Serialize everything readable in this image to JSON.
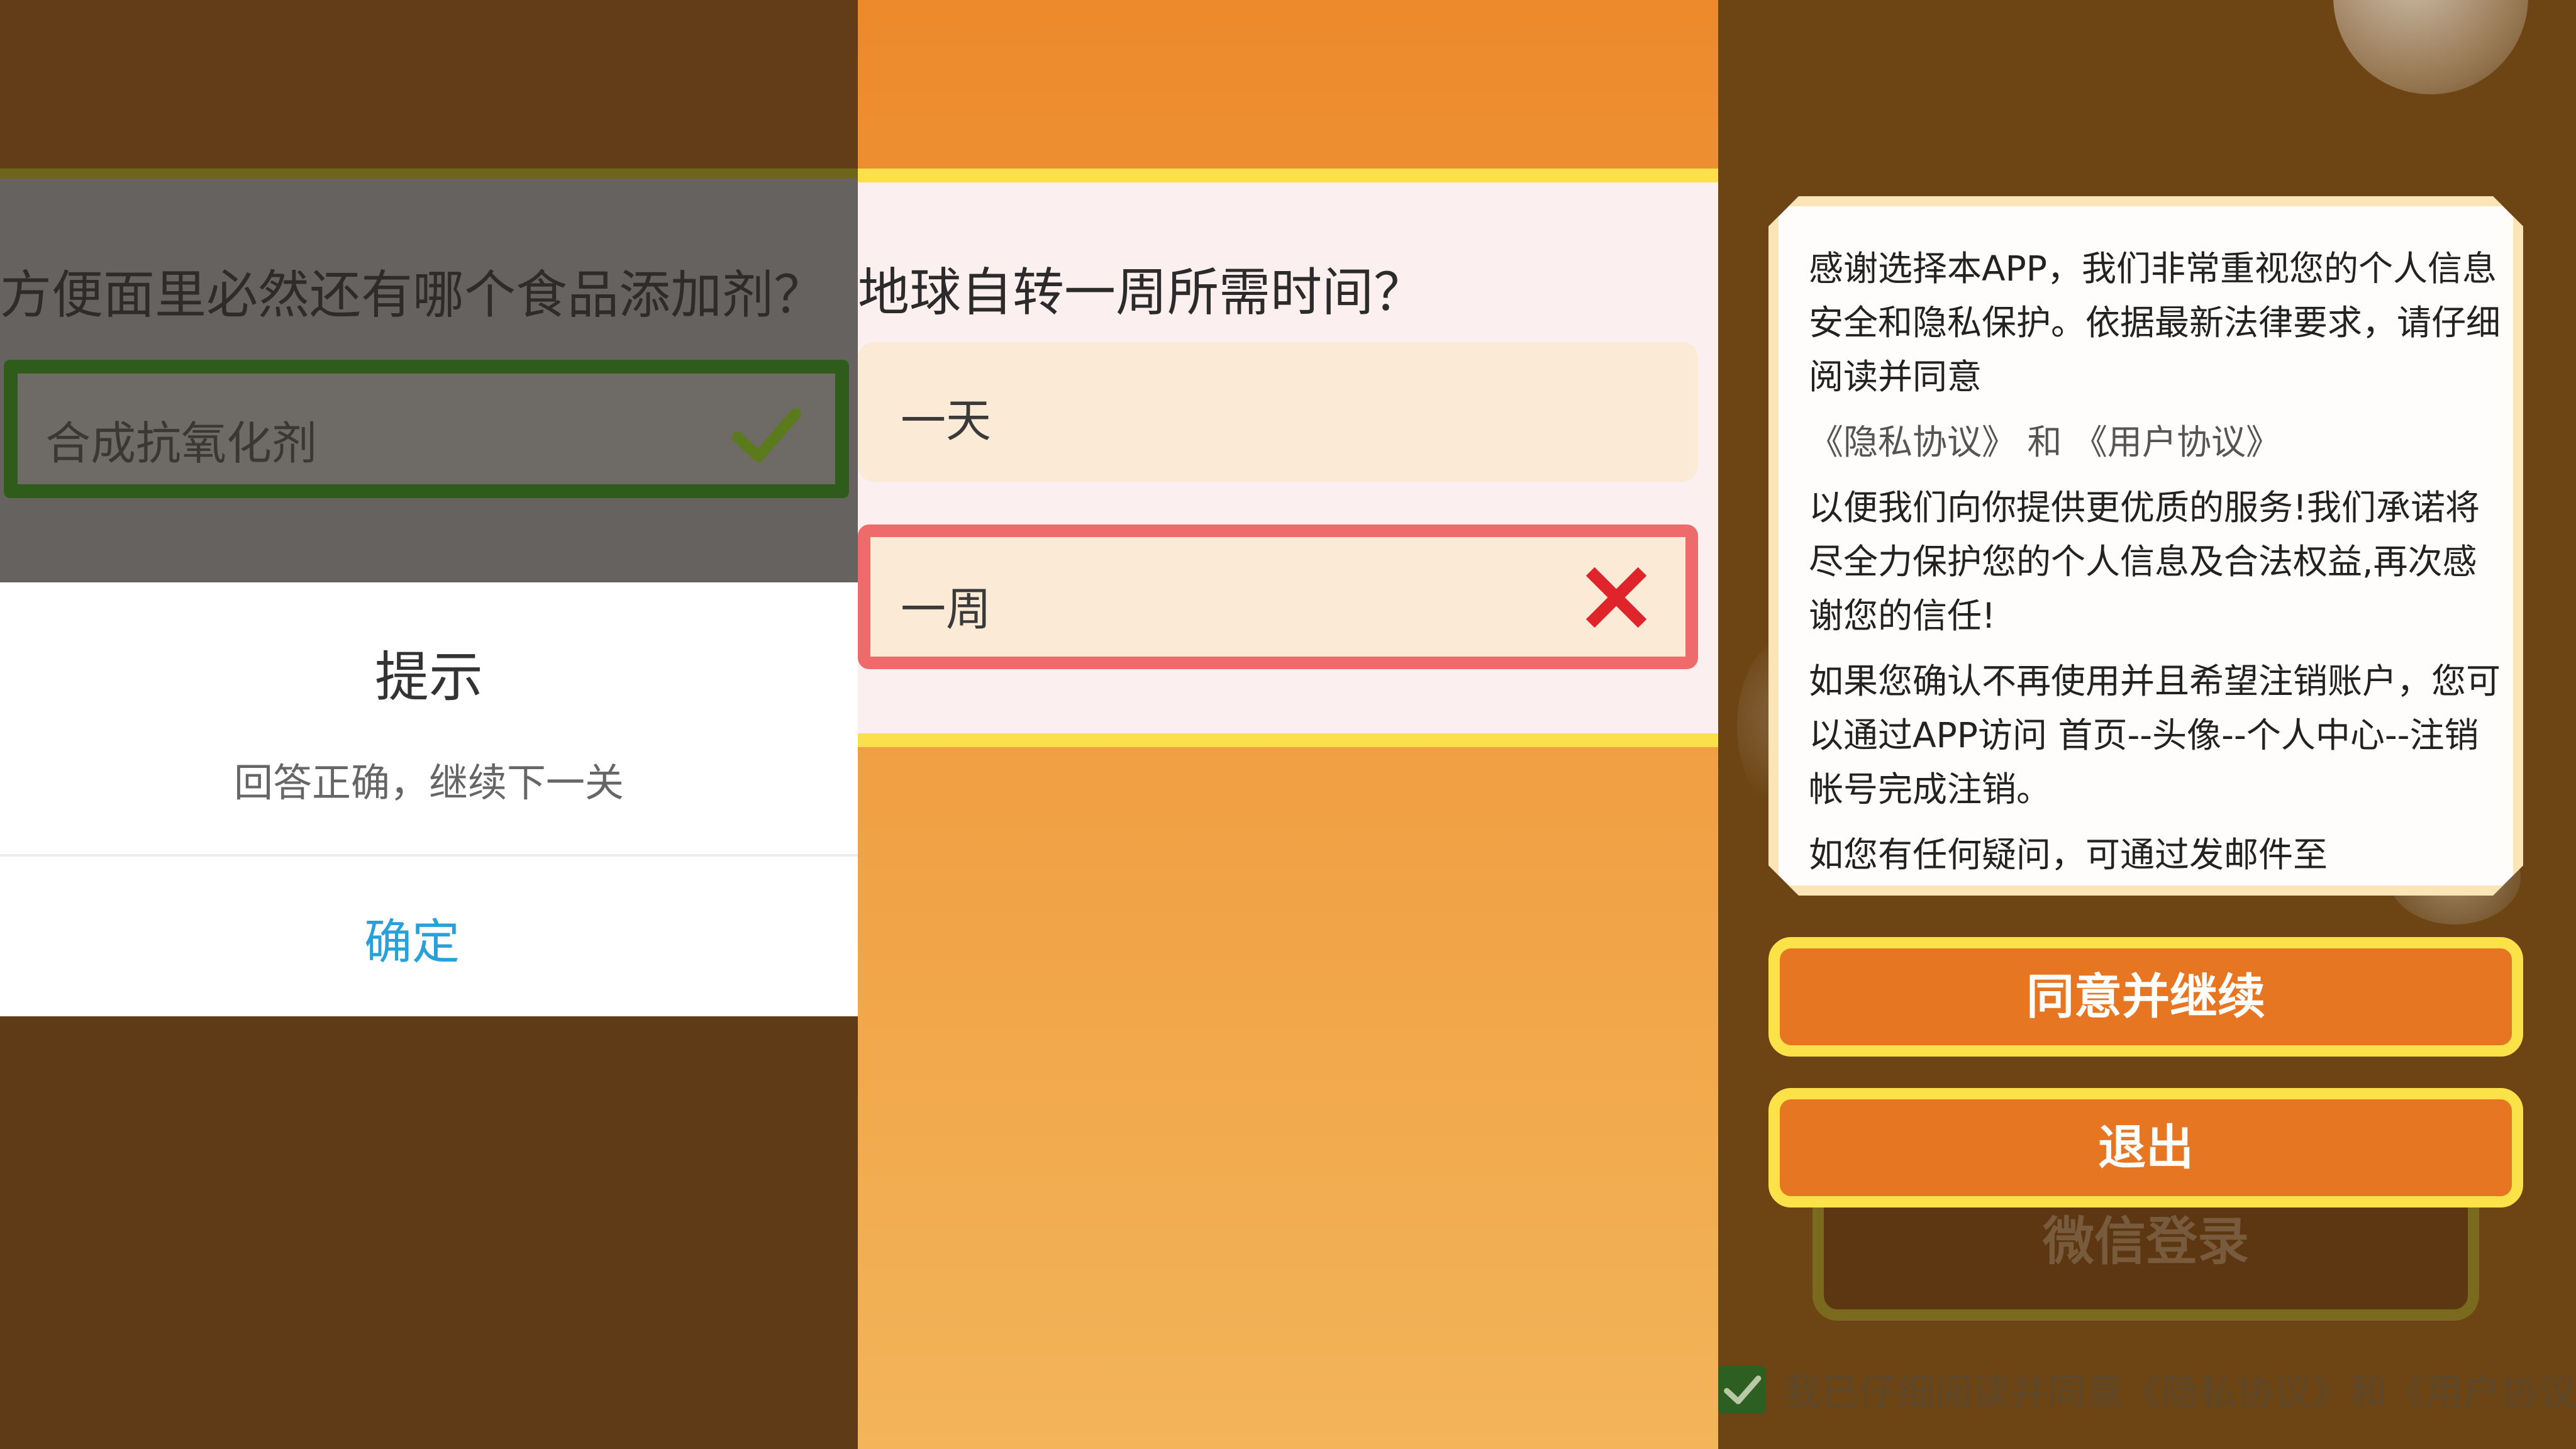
{
  "panel1": {
    "question": "方便面里必然还有哪个食品添加剂？",
    "correct_option": "合成抗氧化剂",
    "dialog": {
      "title": "提示",
      "message": "回答正确，继续下一关",
      "confirm": "确定"
    }
  },
  "panel2": {
    "question": "地球自转一周所需时间？",
    "options": [
      {
        "label": "一天"
      },
      {
        "label": "一周"
      }
    ]
  },
  "panel3": {
    "privacy": {
      "para1": "感谢选择本APP，我们非常重视您的个人信息安全和隐私保护。依据最新法律要求，请仔细阅读并同意",
      "links": "《隐私协议》 和 《用户协议》",
      "para2": "以便我们向你提供更优质的服务!我们承诺将尽全力保护您的个人信息及合法权益,再次感谢您的信任!",
      "para3": "如果您确认不再使用并且希望注销账户，您可以通过APP访问 首页--头像--个人中心--注销帐号完成注销。",
      "para4": "如您有任何疑问，可通过发邮件至"
    },
    "agree_button": "同意并继续",
    "exit_button": "退出",
    "wechat_login": "微信登录",
    "agree_text": "我已仔细阅读并同意《隐私协议》和《用户协议》"
  },
  "colors": {
    "accent_orange": "#e67622",
    "accent_yellow": "#fbe248",
    "correct_green": "#2f5c1b",
    "wrong_red": "#ef6a6a",
    "link_blue": "#2aa0d8"
  },
  "icons": [
    "check-icon",
    "cross-icon",
    "checkbox-icon"
  ]
}
